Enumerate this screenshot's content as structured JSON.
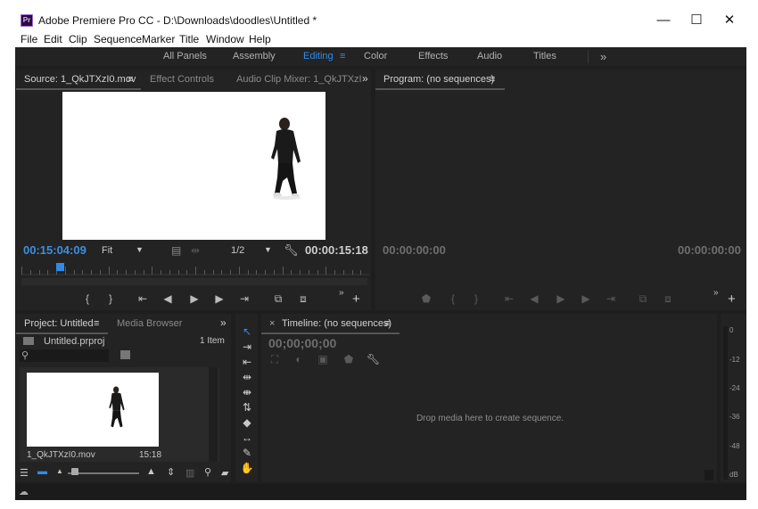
{
  "window": {
    "title": "Adobe Premiere Pro CC - D:\\Downloads\\doodles\\Untitled *",
    "icon_label": "Pr",
    "minimize": "—",
    "maximize": "☐",
    "close": "✕"
  },
  "menu": [
    "File",
    "Edit",
    "Clip",
    "Sequence",
    "Marker",
    "Title",
    "Window",
    "Help"
  ],
  "workspaces": {
    "items": [
      "All Panels",
      "Assembly",
      "Editing",
      "Color",
      "Effects",
      "Audio",
      "Titles"
    ],
    "active": "Editing",
    "more": "»"
  },
  "source": {
    "tabs": [
      "Source: 1_QkJTXzI0.mov",
      "Effect Controls",
      "Audio Clip Mixer: 1_QkJTXzI"
    ],
    "menu_icon": "≡",
    "more": "»",
    "timecode_in": "00:15:04:09",
    "zoom": "Fit",
    "resolution": "1/2",
    "timecode_dur": "00:00:15:18",
    "playhead_fraction": 0.11
  },
  "program": {
    "tab": "Program: (no sequences)",
    "menu_icon": "≡",
    "timecode_left": "00:00:00:00",
    "timecode_right": "00:00:00:00"
  },
  "project": {
    "tabs": [
      "Project: Untitled",
      "Media Browser"
    ],
    "menu_icon": "≡",
    "more": "»",
    "file": "Untitled.prproj",
    "count": "1 Item",
    "clip_name": "1_QkJTXzI0.mov",
    "clip_duration": "15:18"
  },
  "timeline": {
    "close": "×",
    "tab": "Timeline: (no sequences)",
    "menu_icon": "≡",
    "timecode": "00;00;00;00",
    "empty_message": "Drop media here to create sequence."
  },
  "meter": {
    "labels": [
      "0",
      "-12",
      "-24",
      "-36",
      "-48",
      "dB"
    ]
  },
  "colors": {
    "accent": "#2d8ceb",
    "timecode_blue": "#3c8ee0",
    "panel": "#232323",
    "background": "#1e1e1e"
  }
}
